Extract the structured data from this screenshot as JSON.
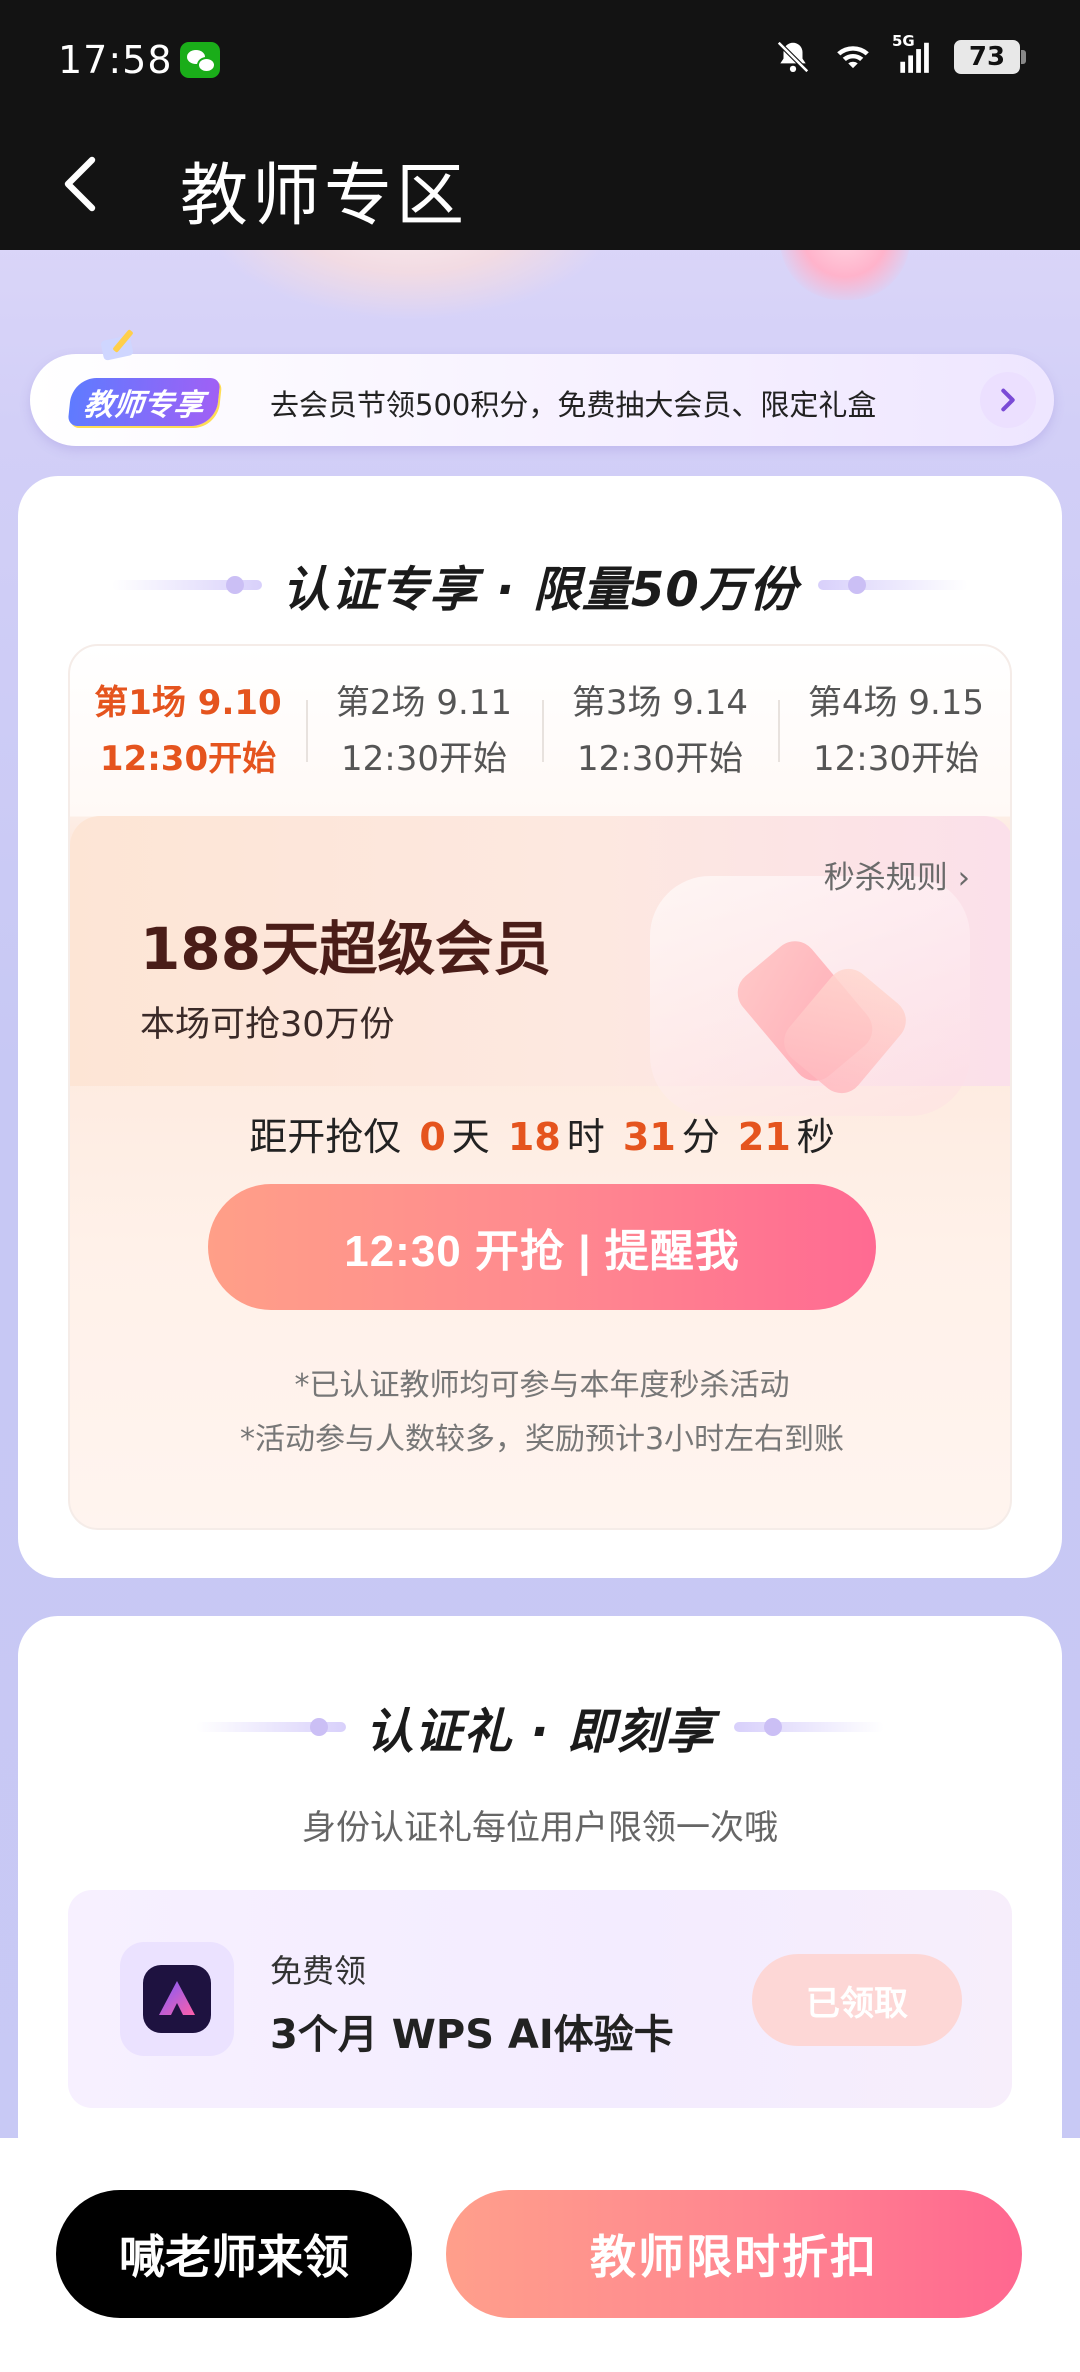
{
  "status_bar": {
    "time": "17:58",
    "signal_label": "5G",
    "battery": "73"
  },
  "header": {
    "title": "教师专区"
  },
  "promo": {
    "badge": "教师专享",
    "text": "去会员节领500积分，免费抽大会员、限定礼盒"
  },
  "flash_sale": {
    "title": "认证专享 · 限量50万份",
    "sessions": [
      {
        "label": "第1场 9.10",
        "time": "12:30开始",
        "active": true
      },
      {
        "label": "第2场 9.11",
        "time": "12:30开始",
        "active": false
      },
      {
        "label": "第3场 9.14",
        "time": "12:30开始",
        "active": false
      },
      {
        "label": "第4场 9.15",
        "time": "12:30开始",
        "active": false
      }
    ],
    "rules_link": "秒杀规则 ›",
    "product_name": "188天超级会员",
    "product_sub": "本场可抢30万份",
    "countdown": {
      "prefix": "距开抢仅",
      "days": "0",
      "days_unit": "天",
      "hours": "18",
      "hours_unit": "时",
      "minutes": "31",
      "minutes_unit": "分",
      "seconds": "21",
      "seconds_unit": "秒"
    },
    "button": "12:30 开抢 | 提醒我",
    "notes": [
      "*已认证教师均可参与本年度秒杀活动",
      "*活动参与人数较多，奖励预计3小时左右到账"
    ]
  },
  "cert_gift": {
    "title": "认证礼 · 即刻享",
    "subtitle": "身份认证礼每位用户限领一次哦",
    "item": {
      "label": "免费领",
      "name": "3个月 WPS AI体验卡",
      "button": "已领取"
    }
  },
  "bottom": {
    "left_button": "喊老师来领",
    "right_button": "教师限时折扣"
  },
  "colors": {
    "accent_orange": "#e5541e",
    "pink_gradient_end": "#ff6a92",
    "header_bg": "#131313"
  }
}
